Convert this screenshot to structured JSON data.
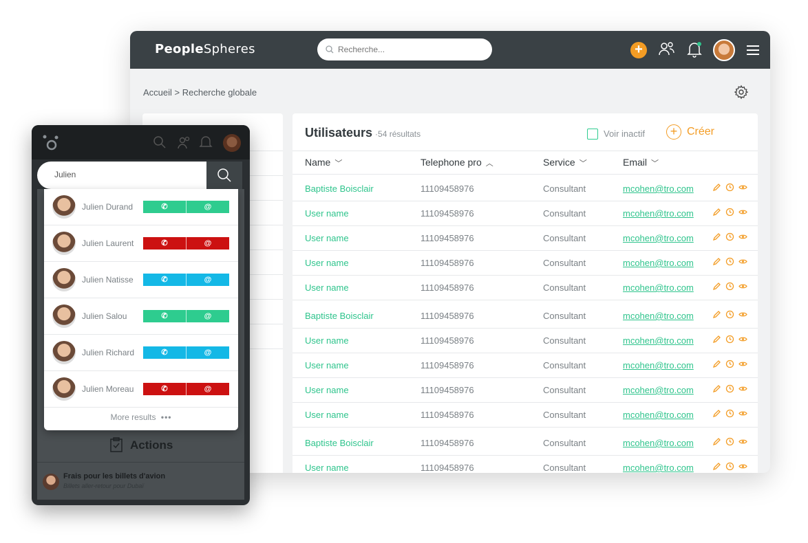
{
  "colors": {
    "accent_orange": "#f39c24",
    "accent_green": "#2ec48c",
    "topbar": "#3a4145",
    "btn_green": "#2ecc8f",
    "btn_red": "#cc1111",
    "btn_blue": "#14b8e6"
  },
  "app": {
    "logo_bold": "Pe",
    "logo_mid": "o",
    "logo_rest_bold": "ple",
    "logo_light": "Spheres"
  },
  "search": {
    "placeholder": "Recherche..."
  },
  "breadcrumb": "Accueil > Recherche globale",
  "users": {
    "title": "Utilisateurs",
    "count": "·54 résultats",
    "inactive_label": "Voir inactif",
    "create_label": "Créer",
    "columns": [
      "Name",
      "Telephone pro",
      "Service",
      "Email"
    ],
    "rows": [
      {
        "name": "Baptiste Boisclair",
        "tel": "11109458976",
        "service": "Consultant",
        "email": "mcohen@tro.com"
      },
      {
        "name": "User name",
        "tel": "11109458976",
        "service": "Consultant",
        "email": "mcohen@tro.com"
      },
      {
        "name": "User name",
        "tel": "11109458976",
        "service": "Consultant",
        "email": "mcohen@tro.com"
      },
      {
        "name": "User name",
        "tel": "11109458976",
        "service": "Consultant",
        "email": "mcohen@tro.com"
      },
      {
        "name": "User name",
        "tel": "11109458976",
        "service": "Consultant",
        "email": "mcohen@tro.com"
      },
      {
        "name": "Baptiste Boisclair",
        "tel": "11109458976",
        "service": "Consultant",
        "email": "mcohen@tro.com"
      },
      {
        "name": "User name",
        "tel": "11109458976",
        "service": "Consultant",
        "email": "mcohen@tro.com"
      },
      {
        "name": "User name",
        "tel": "11109458976",
        "service": "Consultant",
        "email": "mcohen@tro.com"
      },
      {
        "name": "User name",
        "tel": "11109458976",
        "service": "Consultant",
        "email": "mcohen@tro.com"
      },
      {
        "name": "User name",
        "tel": "11109458976",
        "service": "Consultant",
        "email": "mcohen@tro.com"
      },
      {
        "name": "Baptiste Boisclair",
        "tel": "11109458976",
        "service": "Consultant",
        "email": "mcohen@tro.com"
      },
      {
        "name": "User name",
        "tel": "11109458976",
        "service": "Consultant",
        "email": "mcohen@tro.com"
      }
    ]
  },
  "mobile": {
    "search_value": "Julien",
    "results": [
      {
        "name": "Julien Durand",
        "color": "#2ecc8f",
        "call": "✆",
        "mail": "@"
      },
      {
        "name": "Julien Laurent",
        "color": "#cc1111",
        "call": "✆",
        "mail": "@"
      },
      {
        "name": "Julien Natisse",
        "color": "#14b8e6",
        "call": "✆",
        "mail": "@"
      },
      {
        "name": "Julien Salou",
        "color": "#2ecc8f",
        "call": "✆",
        "mail": "@"
      },
      {
        "name": "Julien Richard",
        "color": "#14b8e6",
        "call": "✆",
        "mail": "@"
      },
      {
        "name": "Julien Moreau",
        "color": "#cc1111",
        "call": "✆",
        "mail": "@"
      }
    ],
    "more": "More results",
    "actions_label": "Actions",
    "task_title": "Frais pour les billets d'avion",
    "task_sub": "Billets aller-retour pour Dubaï"
  }
}
